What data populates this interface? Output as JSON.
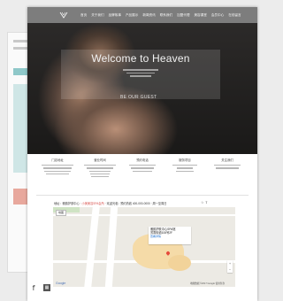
{
  "nav": {
    "items": [
      "首页",
      "关于我们",
      "品牌故事",
      "产品展示",
      "新闻资讯",
      "联系我们",
      "加盟代理",
      "美容课堂",
      "会员中心",
      "在线留言"
    ]
  },
  "hero": {
    "title": "Welcome to Heaven",
    "button": "BE OUR GUEST"
  },
  "info": {
    "columns": [
      "门店地址",
      "营业时间",
      "预约电话",
      "服务项目",
      "关注我们"
    ]
  },
  "address": {
    "text": "地址：雅韵护肤中心 ·",
    "highlight": "小美美容SPA会所",
    "rest": "· 欢迎光临 · 预约热线 400-000-0000 · 周一至周日"
  },
  "map": {
    "tab": "地图",
    "place": "雅韵护肤中心SPA馆",
    "addr": "芳香街道106号2F",
    "link": "查看详情",
    "brand": "Google",
    "terms": "地图数据 ©2017 Google 使用条款"
  },
  "social": {
    "facebook": "f"
  },
  "colors": {
    "nav_bg": "#7d7d7d",
    "hero_bg": "#2c2a29",
    "map_bg": "#eceae4"
  }
}
